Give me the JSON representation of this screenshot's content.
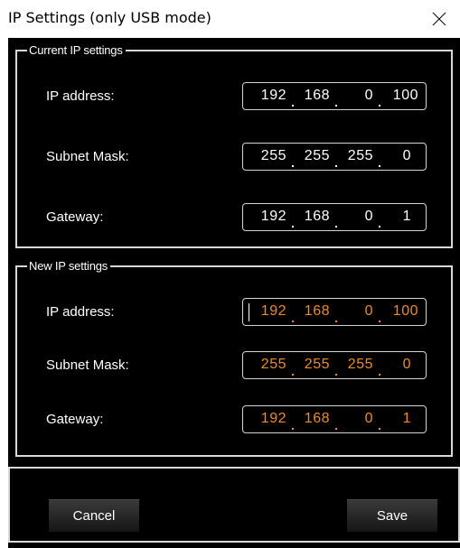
{
  "window": {
    "title": "IP Settings (only USB mode)"
  },
  "current": {
    "legend": "Current IP settings",
    "rows": [
      {
        "label": "IP address:",
        "octets": [
          "192",
          "168",
          "0",
          "100"
        ]
      },
      {
        "label": "Subnet Mask:",
        "octets": [
          "255",
          "255",
          "255",
          "0"
        ]
      },
      {
        "label": "Gateway:",
        "octets": [
          "192",
          "168",
          "0",
          "1"
        ]
      }
    ]
  },
  "new_settings": {
    "legend": "New IP settings",
    "rows": [
      {
        "label": "IP address:",
        "octets": [
          "192",
          "168",
          "0",
          "100"
        ]
      },
      {
        "label": "Subnet Mask:",
        "octets": [
          "255",
          "255",
          "255",
          "0"
        ]
      },
      {
        "label": "Gateway:",
        "octets": [
          "192",
          "168",
          "0",
          "1"
        ]
      }
    ]
  },
  "buttons": {
    "cancel": "Cancel",
    "save": "Save"
  },
  "colors": {
    "background": "#000000",
    "current_value": "#ffffff",
    "new_value": "#f08c1e",
    "border": "#d8d8d8"
  },
  "icons": {
    "close": "close-icon"
  }
}
